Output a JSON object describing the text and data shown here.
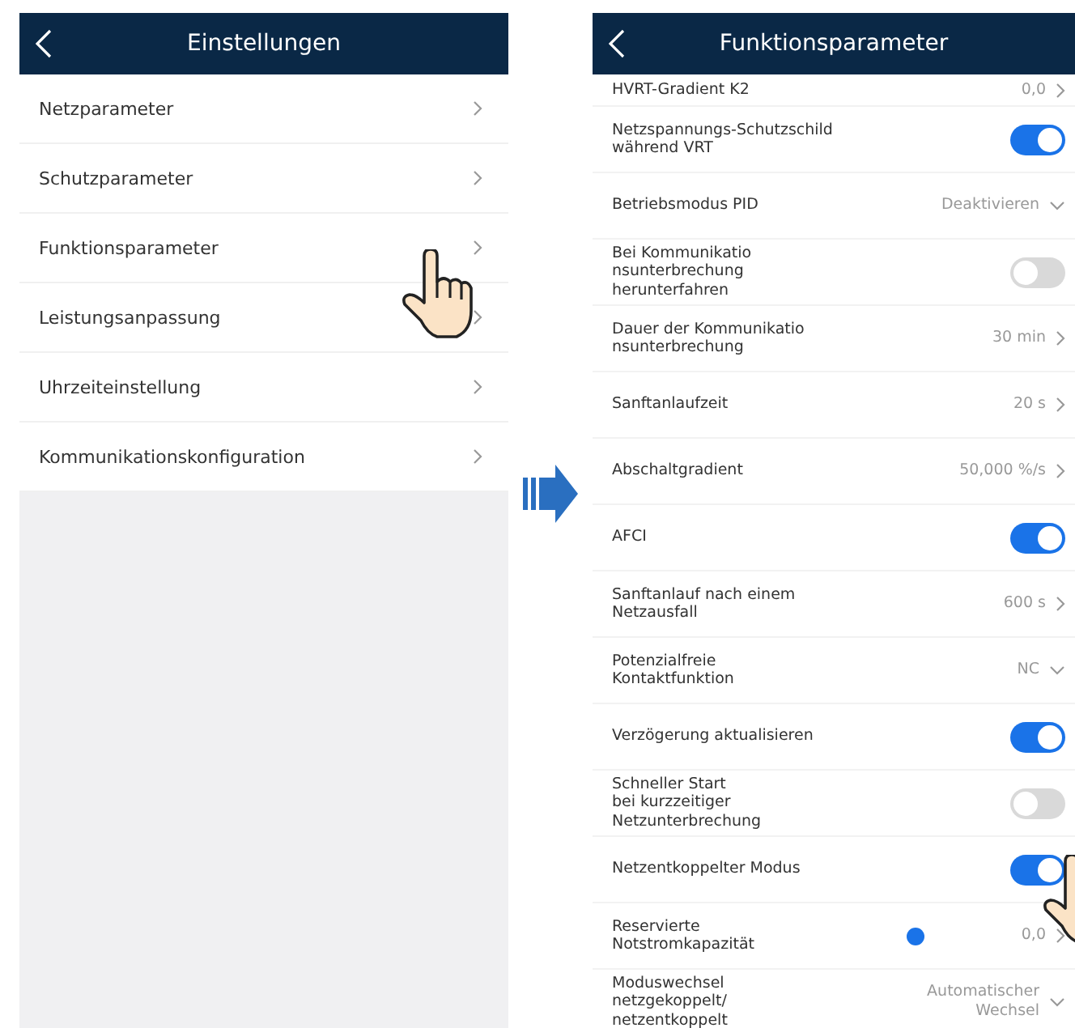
{
  "left_screen": {
    "title": "Einstellungen",
    "items": [
      {
        "label": "Netzparameter"
      },
      {
        "label": "Schutzparameter"
      },
      {
        "label": "Funktionsparameter"
      },
      {
        "label": "Leistungsanpassung"
      },
      {
        "label": "Uhrzeiteinstellung"
      },
      {
        "label": "Kommunikationskonfiguration"
      }
    ]
  },
  "right_screen": {
    "title": "Funktionsparameter",
    "rows": [
      {
        "kind": "value",
        "label": "HVRT-Gradient K2",
        "value": "0,0"
      },
      {
        "kind": "toggle",
        "label": "Netzspannungs-Schutzschild\nwährend VRT",
        "on": true
      },
      {
        "kind": "select",
        "label": "Betriebsmodus PID",
        "value": "Deaktivieren"
      },
      {
        "kind": "toggle",
        "label": "Bei Kommunikatio\nnsunterbrechung\nherunterfahren",
        "on": false
      },
      {
        "kind": "value",
        "label": "Dauer der Kommunikatio\nnsunterbrechung",
        "value": "30 min"
      },
      {
        "kind": "value",
        "label": "Sanftanlaufzeit",
        "value": "20 s"
      },
      {
        "kind": "value",
        "label": "Abschaltgradient",
        "value": "50,000 %/s"
      },
      {
        "kind": "toggle",
        "label": "AFCI",
        "on": true
      },
      {
        "kind": "value",
        "label": "Sanftanlauf nach einem\nNetzausfall",
        "value": "600 s"
      },
      {
        "kind": "select",
        "label": "Potenzialfreie\nKontaktfunktion",
        "value": "NC"
      },
      {
        "kind": "toggle",
        "label": "Verzögerung aktualisieren",
        "on": true
      },
      {
        "kind": "toggle",
        "label": "Schneller Start\nbei kurzzeitiger\nNetzunterbrechung",
        "on": false
      },
      {
        "kind": "toggle",
        "label": "Netzentkoppelter Modus",
        "on": true
      },
      {
        "kind": "value",
        "label": "Reservierte\nNotstromkapazität",
        "value": "0,0",
        "info": true
      },
      {
        "kind": "select",
        "label": "Moduswechsel\nnetzgekoppelt/\nnetzentkoppelt",
        "value": "Automatischer\nWechsel"
      }
    ]
  }
}
